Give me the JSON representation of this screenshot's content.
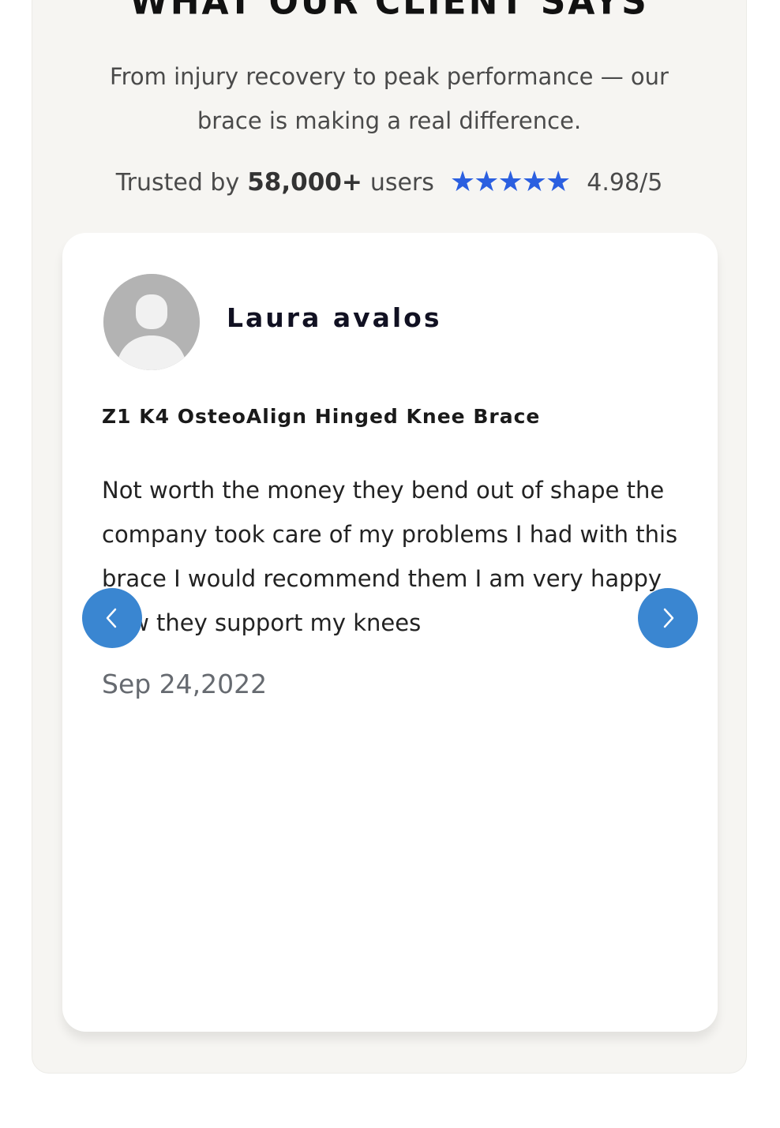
{
  "section": {
    "heading": "WHAT OUR CLIENT SAYS",
    "subtext": "From injury recovery to peak performance — our brace is making a real difference.",
    "trust": {
      "prefix": "Trusted by",
      "count": "58,000+",
      "suffix": "users",
      "stars": 5,
      "rating": "4.98/5",
      "star_color": "#2b5fe0"
    }
  },
  "review": {
    "reviewer_name": "Laura avalos",
    "product": "Z1 K4 OsteoAlign Hinged Knee Brace",
    "text": "Not worth the money they bend out of shape the company took care of my problems I had with this brace I would recommend them I am very happy how they support my knees",
    "date": "Sep 24,2022",
    "avatar_icon": "user-placeholder-icon"
  },
  "carousel": {
    "prev_icon": "chevron-left-icon",
    "next_icon": "chevron-right-icon",
    "button_color": "#3a86d1"
  }
}
